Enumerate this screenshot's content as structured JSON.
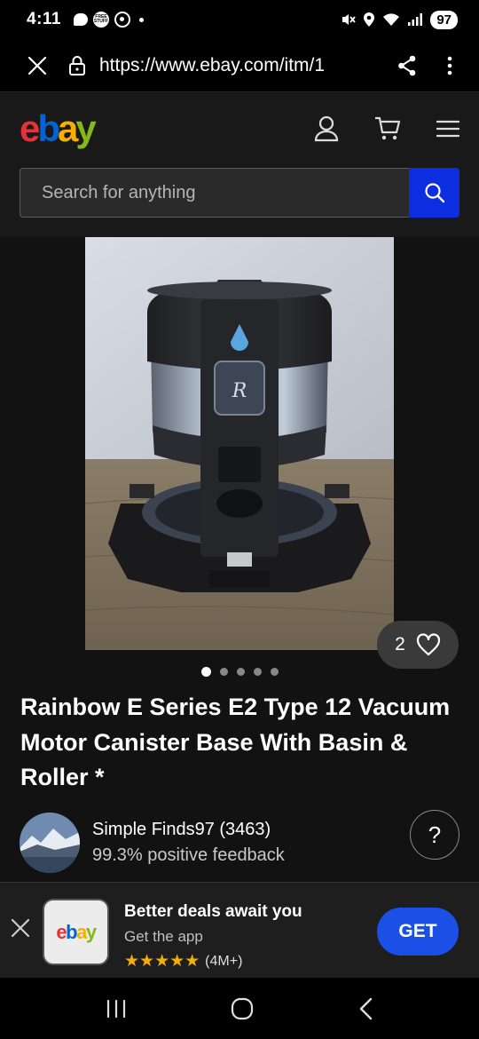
{
  "status_bar": {
    "time": "4:11",
    "battery": "97"
  },
  "browser": {
    "url": "https://www.ebay.com/itm/1"
  },
  "search": {
    "placeholder": "Search for anything"
  },
  "product": {
    "watch_count": "2",
    "image_count": 5,
    "active_image": 0,
    "title": "Rainbow E Series E2 Type 12 Vacuum Motor Canister Base With Basin & Roller *"
  },
  "seller": {
    "name": "Simple Finds97 (3463)",
    "feedback": "99.3% positive feedback",
    "help_label": "?"
  },
  "app_banner": {
    "title": "Better deals await you",
    "subtitle": "Get the app",
    "stars": "★★★★★",
    "rating_count": "(4M+)",
    "cta": "GET",
    "icon_logo": "ebay"
  },
  "colors": {
    "ebay_red": "#e53238",
    "ebay_blue": "#0064d2",
    "ebay_yellow": "#f5af02",
    "ebay_green": "#86b817",
    "search_button": "#0d2ee0",
    "get_button": "#1a50e6"
  }
}
